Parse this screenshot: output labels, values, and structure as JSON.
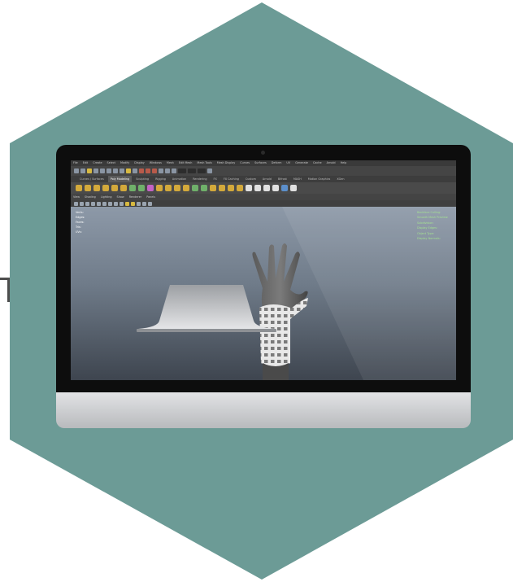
{
  "colors": {
    "hexagon": "#6c9b96",
    "bezel": "#0d0d0d",
    "chin": "#c9cbce",
    "viewport_top": "#8d99a8",
    "viewport_bottom": "#3e454f",
    "attribute_text": "#9ee08a"
  },
  "icons": {
    "camera": "webcam-dot",
    "tick": "connector-bracket"
  },
  "app": {
    "menus": [
      "File",
      "Edit",
      "Create",
      "Select",
      "Modify",
      "Display",
      "Windows",
      "Mesh",
      "Edit Mesh",
      "Mesh Tools",
      "Mesh Display",
      "Curves",
      "Surfaces",
      "Deform",
      "UV",
      "Generate",
      "Cache",
      "Arnold",
      "Help"
    ],
    "shelf_tabs": [
      "Curves / Surfaces",
      "Poly Modeling",
      "Sculpting",
      "Rigging",
      "Animation",
      "Rendering",
      "FX",
      "FX Caching",
      "Custom",
      "Arnold",
      "Bifrost",
      "MASH",
      "Motion Graphics",
      "XGen"
    ],
    "active_shelf_tab": "Poly Modeling",
    "panel_menus": [
      "View",
      "Shading",
      "Lighting",
      "Show",
      "Renderer",
      "Panels"
    ],
    "hud": {
      "rows": [
        {
          "name": "Verts:",
          "a": "",
          "b": "",
          "c": ""
        },
        {
          "name": "Edges:",
          "a": "",
          "b": "",
          "c": ""
        },
        {
          "name": "Faces:",
          "a": "",
          "b": "",
          "c": ""
        },
        {
          "name": "Tris:",
          "a": "",
          "b": "",
          "c": ""
        },
        {
          "name": "UVs:",
          "a": "",
          "b": "",
          "c": ""
        }
      ]
    },
    "attribute_panel": [
      "Backface Culling:",
      "Smooth Mesh Preview:",
      "Subdivision:",
      "Display Edges:",
      "Object Type:",
      "Display Normals:"
    ]
  }
}
